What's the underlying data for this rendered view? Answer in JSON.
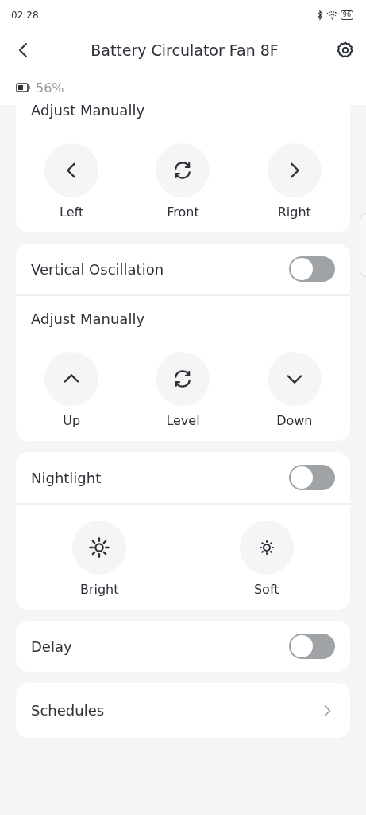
{
  "status_bar": {
    "time": "02:28",
    "battery": "96"
  },
  "header": {
    "title": "Battery Circulator Fan 8F"
  },
  "device_battery": {
    "text": "56%"
  },
  "cards": [
    {
      "rows": [
        {
          "kind": "heading",
          "label": "Adjust Manually"
        },
        {
          "kind": "buttons",
          "items": [
            {
              "kind": "left",
              "label": "Left"
            },
            {
              "kind": "cycle",
              "label": "Front"
            },
            {
              "kind": "right",
              "label": "Right"
            }
          ]
        }
      ]
    },
    {
      "rows": [
        {
          "kind": "toggle",
          "label": "Vertical Oscillation",
          "on": false
        },
        {
          "kind": "heading",
          "label": "Adjust Manually"
        },
        {
          "kind": "buttons",
          "items": [
            {
              "kind": "up",
              "label": "Up"
            },
            {
              "kind": "cycle",
              "label": "Level"
            },
            {
              "kind": "down",
              "label": "Down"
            }
          ]
        }
      ]
    },
    {
      "rows": [
        {
          "kind": "toggle",
          "label": "Nightlight",
          "on": false
        },
        {
          "kind": "buttons",
          "items": [
            {
              "kind": "sun-big",
              "label": "Bright"
            },
            {
              "kind": "sun-small",
              "label": "Soft"
            }
          ]
        }
      ]
    },
    {
      "rows": [
        {
          "kind": "toggle",
          "label": "Delay",
          "on": false
        }
      ]
    },
    {
      "rows": [
        {
          "kind": "link",
          "label": "Schedules"
        }
      ]
    }
  ]
}
